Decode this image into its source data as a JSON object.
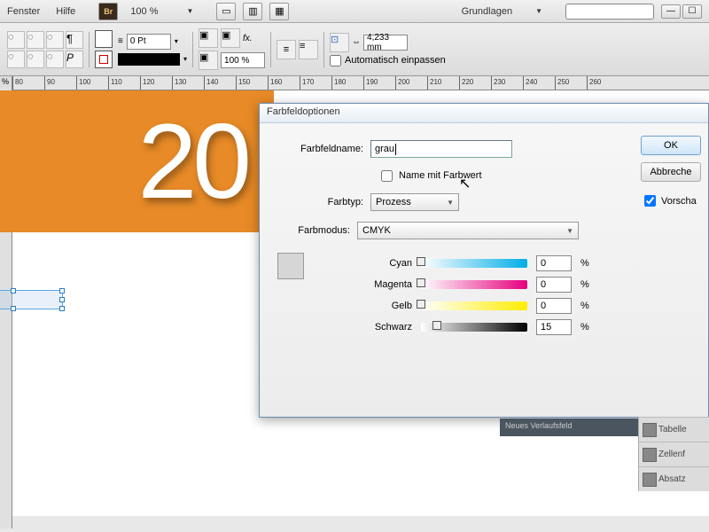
{
  "menu": {
    "items": [
      "Fenster",
      "Hilfe"
    ],
    "zoom": "100 %",
    "workspace": "Grundlagen"
  },
  "toolbar": {
    "stroke_weight": "0 Pt",
    "opacity": "100 %",
    "width_val": "4,233 mm",
    "auto_fit": "Automatisch einpassen"
  },
  "ruler": {
    "unit": "%",
    "marks": [
      80,
      90,
      100,
      110,
      120,
      130,
      140,
      150,
      160,
      170,
      180,
      190,
      200,
      210,
      220,
      230,
      240,
      250,
      260
    ]
  },
  "canvas": {
    "big_text": "20"
  },
  "dialog": {
    "title": "Farbfeldoptionen",
    "name_label": "Farbfeldname:",
    "name_value": "grau",
    "name_with_value": "Name mit Farbwert",
    "type_label": "Farbtyp:",
    "type_value": "Prozess",
    "mode_label": "Farbmodus:",
    "mode_value": "CMYK",
    "sliders": {
      "c": {
        "label": "Cyan",
        "value": "0"
      },
      "m": {
        "label": "Magenta",
        "value": "0"
      },
      "y": {
        "label": "Gelb",
        "value": "0"
      },
      "k": {
        "label": "Schwarz",
        "value": "15"
      }
    },
    "pct": "%",
    "ok": "OK",
    "cancel": "Abbreche",
    "preview": "Vorscha"
  },
  "panels": [
    "Neues Verlaufsfeld",
    "Tabelle",
    "Zellenf",
    "Absatz"
  ]
}
